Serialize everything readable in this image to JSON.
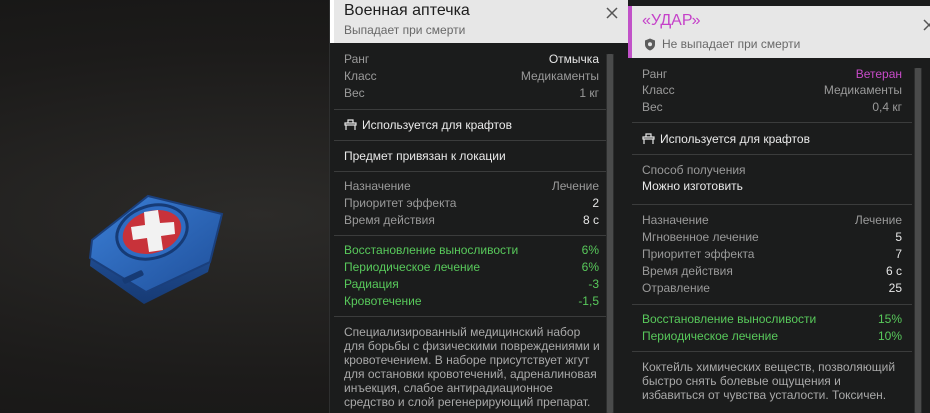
{
  "item_icon": "medkit-icon",
  "colors": {
    "accent_purple": "#c541c9",
    "green": "#58c95b",
    "panel_bg": "#1b1c1c",
    "header_bg": "#e7e7e7"
  },
  "panel1": {
    "title": "Военная аптечка",
    "subtitle": "Выпадает при смерти",
    "stats": [
      {
        "key": "Ранг",
        "value": "Отмычка"
      },
      {
        "key": "Класс",
        "value": "Медикаменты"
      },
      {
        "key": "Вес",
        "value": "1 кг"
      }
    ],
    "craft_label": "Используется для крафтов",
    "location_note": "Предмет привязан к локации",
    "effects": [
      {
        "key": "Назначение",
        "value": "Лечение"
      },
      {
        "key": "Приоритет эффекта",
        "value": "2"
      },
      {
        "key": "Время действия",
        "value": "8 с"
      }
    ],
    "bonuses": [
      {
        "key": "Восстановление выносливости",
        "value": "6%"
      },
      {
        "key": "Периодическое лечение",
        "value": "6%"
      },
      {
        "key": "Радиация",
        "value": "-3"
      },
      {
        "key": "Кровотечение",
        "value": "-1,5"
      }
    ],
    "description": "Специализированный медицинский набор для борьбы с физическими повреждениями и кровотечением. В наборе присутствует жгут для остановки кровотечений, адреналиновая инъекция, слабое антирадиационное средство и слой регенерирующий препарат."
  },
  "panel2": {
    "title": "«УДАР»",
    "subtitle": "Не выпадает при смерти",
    "stats": [
      {
        "key": "Ранг",
        "value": "Ветеран"
      },
      {
        "key": "Класс",
        "value": "Медикаменты"
      },
      {
        "key": "Вес",
        "value": "0,4 кг"
      }
    ],
    "craft_label": "Используется для крафтов",
    "obtain_label": "Способ получения",
    "obtain_value": "Можно изготовить",
    "effects": [
      {
        "key": "Назначение",
        "value": "Лечение"
      },
      {
        "key": "Мгновенное лечение",
        "value": "5"
      },
      {
        "key": "Приоритет эффекта",
        "value": "7"
      },
      {
        "key": "Время действия",
        "value": "6 с"
      },
      {
        "key": "Отравление",
        "value": "25"
      }
    ],
    "bonuses": [
      {
        "key": "Восстановление выносливости",
        "value": "15%"
      },
      {
        "key": "Периодическое лечение",
        "value": "10%"
      }
    ],
    "description": "Коктейль химических веществ, позволяющий быстро снять болевые ощущения и избавиться от чувства усталости. Токсичен."
  }
}
